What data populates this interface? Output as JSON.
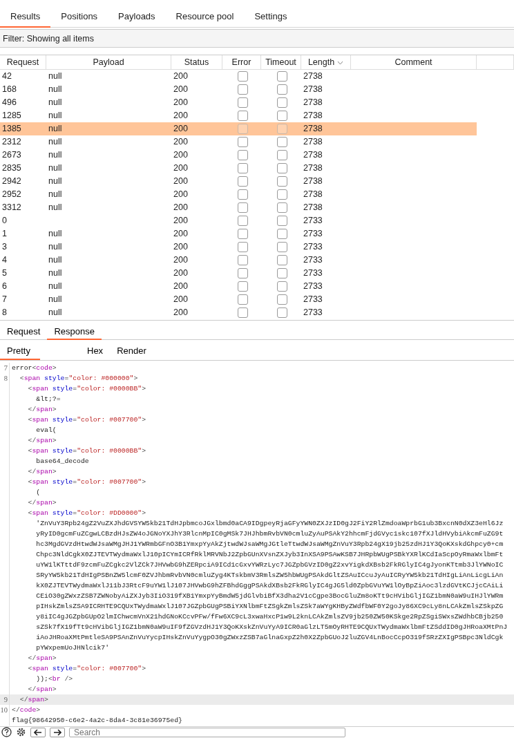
{
  "tabs": [
    {
      "label": "Results",
      "selected": true
    },
    {
      "label": "Positions",
      "selected": false
    },
    {
      "label": "Payloads",
      "selected": false
    },
    {
      "label": "Resource pool",
      "selected": false
    },
    {
      "label": "Settings",
      "selected": false
    }
  ],
  "filter": "Filter: Showing all items",
  "table": {
    "columns": [
      {
        "label": "Request",
        "sorted": false
      },
      {
        "label": "Payload",
        "sorted": false
      },
      {
        "label": "Status",
        "sorted": false
      },
      {
        "label": "Error",
        "sorted": false
      },
      {
        "label": "Timeout",
        "sorted": false
      },
      {
        "label": "Length",
        "sorted": true
      },
      {
        "label": "Comment",
        "sorted": false
      }
    ],
    "rows": [
      {
        "request": "42",
        "payload": "null",
        "status": "200",
        "error": false,
        "timeout": false,
        "length": "2738",
        "selected": false
      },
      {
        "request": "168",
        "payload": "null",
        "status": "200",
        "error": false,
        "timeout": false,
        "length": "2738",
        "selected": false
      },
      {
        "request": "496",
        "payload": "null",
        "status": "200",
        "error": false,
        "timeout": false,
        "length": "2738",
        "selected": false
      },
      {
        "request": "1285",
        "payload": "null",
        "status": "200",
        "error": false,
        "timeout": false,
        "length": "2738",
        "selected": false
      },
      {
        "request": "1385",
        "payload": "null",
        "status": "200",
        "error": false,
        "timeout": false,
        "length": "2738",
        "selected": true
      },
      {
        "request": "2312",
        "payload": "null",
        "status": "200",
        "error": false,
        "timeout": false,
        "length": "2738",
        "selected": false
      },
      {
        "request": "2673",
        "payload": "null",
        "status": "200",
        "error": false,
        "timeout": false,
        "length": "2738",
        "selected": false
      },
      {
        "request": "2835",
        "payload": "null",
        "status": "200",
        "error": false,
        "timeout": false,
        "length": "2738",
        "selected": false
      },
      {
        "request": "2942",
        "payload": "null",
        "status": "200",
        "error": false,
        "timeout": false,
        "length": "2738",
        "selected": false
      },
      {
        "request": "2952",
        "payload": "null",
        "status": "200",
        "error": false,
        "timeout": false,
        "length": "2738",
        "selected": false
      },
      {
        "request": "3312",
        "payload": "null",
        "status": "200",
        "error": false,
        "timeout": false,
        "length": "2738",
        "selected": false
      },
      {
        "request": "0",
        "status": "200",
        "error": false,
        "timeout": false,
        "length": "2733",
        "selected": false
      },
      {
        "request": "1",
        "payload": "null",
        "status": "200",
        "error": false,
        "timeout": false,
        "length": "2733",
        "selected": false
      },
      {
        "request": "3",
        "payload": "null",
        "status": "200",
        "error": false,
        "timeout": false,
        "length": "2733",
        "selected": false
      },
      {
        "request": "4",
        "payload": "null",
        "status": "200",
        "error": false,
        "timeout": false,
        "length": "2733",
        "selected": false
      },
      {
        "request": "5",
        "payload": "null",
        "status": "200",
        "error": false,
        "timeout": false,
        "length": "2733",
        "selected": false
      },
      {
        "request": "6",
        "payload": "null",
        "status": "200",
        "error": false,
        "timeout": false,
        "length": "2733",
        "selected": false
      },
      {
        "request": "7",
        "payload": "null",
        "status": "200",
        "error": false,
        "timeout": false,
        "length": "2733",
        "selected": false
      },
      {
        "request": "8",
        "payload": "null",
        "status": "200",
        "error": false,
        "timeout": false,
        "length": "2733",
        "selected": false
      }
    ]
  },
  "message_tabs": [
    {
      "label": "Request",
      "selected": false
    },
    {
      "label": "Response",
      "selected": true
    }
  ],
  "view_tabs": [
    {
      "label": "Pretty",
      "selected": true
    },
    {
      "label": "Hex",
      "selected": false
    },
    {
      "label": "Render",
      "selected": false
    }
  ],
  "code_lines": [
    {
      "number": "7",
      "text": "error<code>",
      "highlighted": false
    },
    {
      "number": "8",
      "text": "  <span style=\"color: #000000\">",
      "highlighted": false
    },
    {
      "text": "    <span style=\"color: #0000BB\">",
      "highlighted": false
    },
    {
      "text": "      &lt;?=",
      "highlighted": false
    },
    {
      "text": "    </span>",
      "highlighted": false
    },
    {
      "text": "    <span style=\"color: #007700\">",
      "highlighted": false
    },
    {
      "text": "      eval(",
      "highlighted": false
    },
    {
      "text": "    </span>",
      "highlighted": false
    },
    {
      "text": "    <span style=\"color: #0000BB\">",
      "highlighted": false
    },
    {
      "text": "      base64_decode",
      "highlighted": false
    },
    {
      "text": "    </span>",
      "highlighted": false
    },
    {
      "text": "    <span style=\"color: #007700\">",
      "highlighted": false
    },
    {
      "text": "      (",
      "highlighted": false
    },
    {
      "text": "    </span>",
      "highlighted": false
    },
    {
      "text": "    <span style=\"color: #DD0000\">",
      "highlighted": false
    },
    {
      "text": "      'ZnVuY3Rpb24gZ2VuZXJhdGVSYW5kb21TdHJpbmcoJGxlbmd0aCA9IDgpeyRjaGFyYWN0ZXJzID0gJ2FiY2RlZmdoaWprbG1ub3BxcnN0dXZ3eHl6Jz",
      "highlighted": false
    },
    {
      "text": "      yRyID0gcmFuZCgwLCBzdHJsZW4oJGNoYXJhY3RlcnMpIC0gMSk7JHJhbmRvbVN0cmluZyAuPSAkY2hhcmFjdGVyc1skc107fXJldHVybiAkcmFuZG9t",
      "highlighted": false
    },
    {
      "text": "      hc3MgdGVzdHtwdWJsaWMgJHJ1YWRmbGFnO3B1YmxpYyAkZjtwdWJsaWMgJGtleTtwdWJsaWMgZnVuY3Rpb24gX19jb25zdHJ1Y3QoKXskdGhpcy0+cm",
      "highlighted": false
    },
    {
      "text": "      Chpc3NldCgkX0ZJTEVTWydmaWxlJ10pICYmICRfRklMRVNbJ2ZpbGUnXVsnZXJyb3InXSA9PSAwKSB7JHRpbWUgPSBkYXRlKCdIaScpOyRmaWxlbmFt",
      "highlighted": false
    },
    {
      "text": "      uYW1lKTttdF9zcmFuZCgkc2VlZCk7JHVwbG9hZERpciA9ICd1cGxvYWRzLyc7JGZpbGVzID0gZ2xvYigkdXBsb2FkRGlyIC4gJyonKTtmb3JlYWNoIC",
      "highlighted": false
    },
    {
      "text": "      SRyYW5kb21TdHIgPSBnZW5lcmF0ZVJhbmRvbVN0cmluZyg4KTskbmV3RmlsZW5hbWUgPSAkdGltZSAuICcuJyAuICRyYW5kb21TdHIgLiAnLicgLiAn",
      "highlighted": false
    },
    {
      "text": "      kX0ZJTEVTWydmaWxlJ11bJ3RtcF9uYW1lJ107JHVwbG9hZFBhdGggPSAkdXBsb2FkRGlyIC4gJG5ld0ZpbGVuYW1lOyBpZiAoc3lzdGVtKCJjcCAiLi",
      "highlighted": false
    },
    {
      "text": "      CEiO30gZWxzZSB7ZWNobyAiZXJyb3IiO319fXB1YmxpYyBmdW5jdGlvbiBfX3dha2V1cCgpe3BocGluZm8oKTt9cHVibGljIGZ1bmN0aW9uIHJlYWRm",
      "highlighted": false
    },
    {
      "text": "      pIHskZmlsZSA9ICRHTE9CQUxTWydmaWxlJ107JGZpbGUgPSBiYXNlbmFtZSgkZmlsZSk7aWYgKHByZWdfbWF0Y2goJy86XC9cLy8nLCAkZmlsZSkpZG",
      "highlighted": false
    },
    {
      "text": "      y8iIC4gJGZpbGUpO2lmIChwcmVnX21hdGNoKCcvPFw/fFw6XC9cL3xwaHxcP1w9L2knLCAkZmlsZV9jb250ZW50KSkge2RpZSgiSWxsZWdhbCBjb250",
      "highlighted": false
    },
    {
      "text": "      sZSk7fX19fTt9cHVibGljIGZ1bmN0aW9uIF9fZGVzdHJ1Y3QoKXskZnVuYyA9ICR0aGlzLT5mOyRHTE9CQUxTWydmaWxlbmFtZSddID0gJHRoaXMtPnJ",
      "highlighted": false
    },
    {
      "text": "      iAoJHRoaXMtPmtleSA9PSAnZnVuYycpIHskZnVuYygpO30gZWxzZSB7aGlnaGxpZ2h0X2ZpbGUoJ2luZGV4LnBocCcpO319fSRzZXIgPSBpc3NldCgk",
      "highlighted": false
    },
    {
      "text": "      pYWxpemUoJHNlcik7'",
      "highlighted": false
    },
    {
      "text": "    </span>",
      "highlighted": false
    },
    {
      "text": "    <span style=\"color: #007700\">",
      "highlighted": false
    },
    {
      "text": "      ));<br />",
      "highlighted": false
    },
    {
      "text": "    </span>",
      "highlighted": false
    },
    {
      "number": "9",
      "text": "  </span>",
      "highlighted": true
    },
    {
      "number": "10",
      "text": "</code>",
      "highlighted": false
    },
    {
      "text": "flag{98642950-c6e2-4a2c-8da4-3c81e36975ed}",
      "highlighted": false
    }
  ],
  "search": {
    "placeholder": "Search"
  }
}
